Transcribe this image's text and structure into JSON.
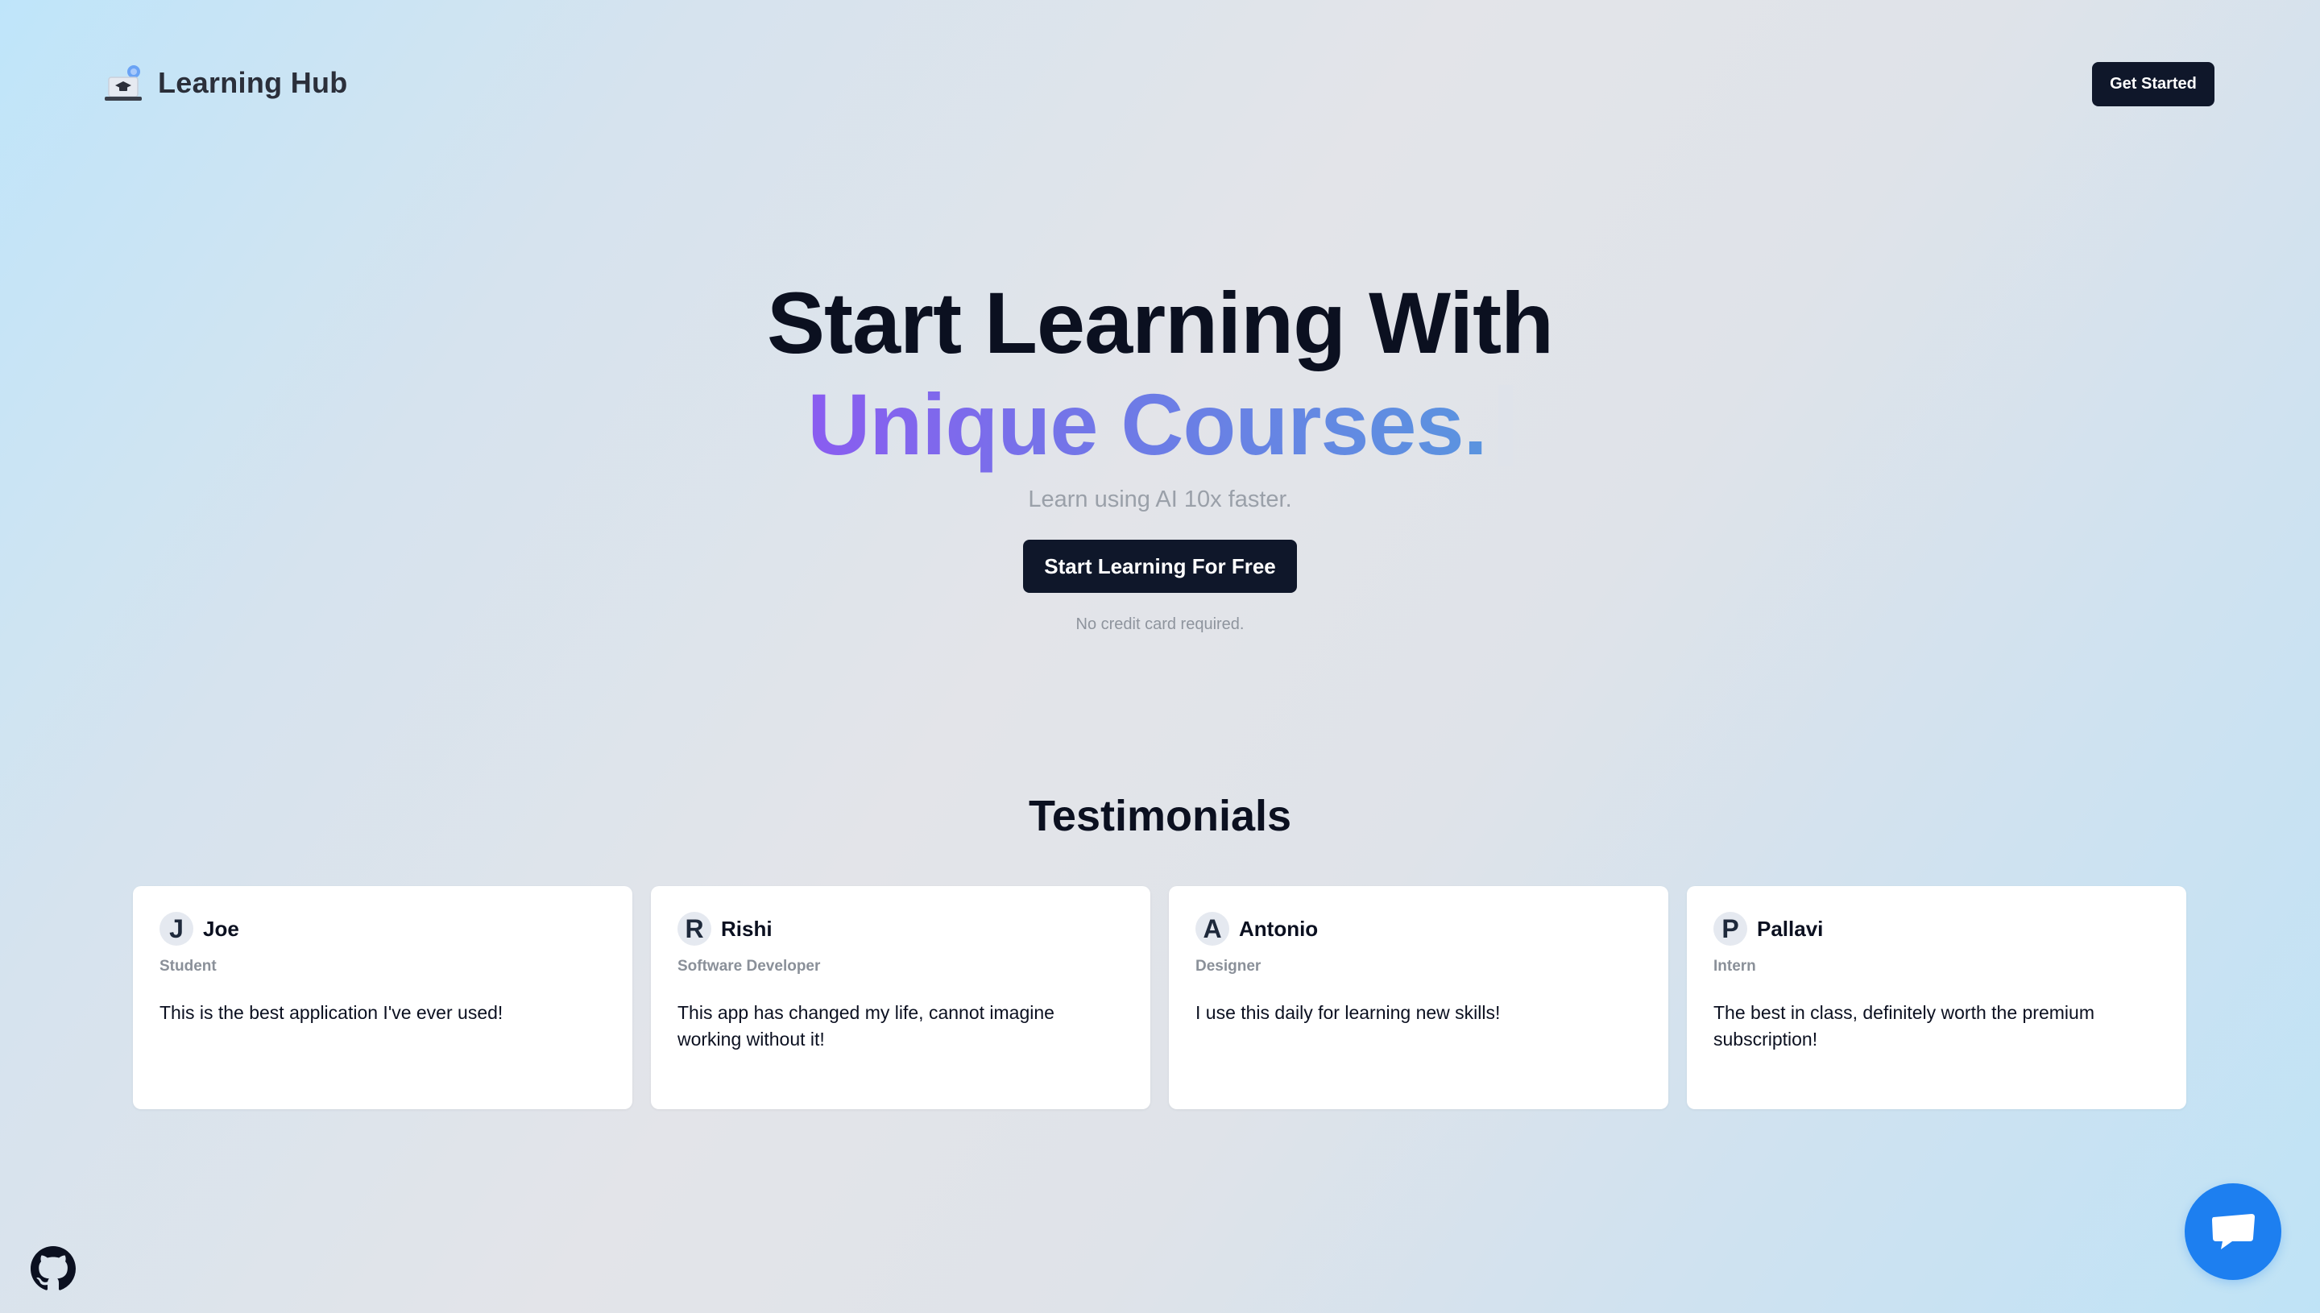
{
  "header": {
    "brand_name": "Learning Hub",
    "logo_icon": "laptop-graduation-cap-icon",
    "get_started_label": "Get Started"
  },
  "hero": {
    "title_line1": "Start Learning With",
    "title_line2": "Unique Courses.",
    "subtitle": "Learn using AI 10x faster.",
    "cta_label": "Start Learning For Free",
    "cta_note": "No credit card required."
  },
  "testimonials": {
    "title": "Testimonials",
    "items": [
      {
        "initial": "J",
        "name": "Joe",
        "role": "Student",
        "text": "This is the best application I've ever used!"
      },
      {
        "initial": "R",
        "name": "Rishi",
        "role": "Software Developer",
        "text": "This app has changed my life, cannot imagine working without it!"
      },
      {
        "initial": "A",
        "name": "Antonio",
        "role": "Designer",
        "text": "I use this daily for learning new skills!"
      },
      {
        "initial": "P",
        "name": "Pallavi",
        "role": "Intern",
        "text": "The best in class, definitely worth the premium subscription!"
      }
    ]
  },
  "footer": {
    "github_icon": "github-icon",
    "chat_icon": "chat-icon"
  },
  "colors": {
    "primary_dark": "#0f172a",
    "gradient_start": "#8a5cf0",
    "gradient_end": "#5a94df",
    "chat_blue": "#1d7ff0"
  }
}
